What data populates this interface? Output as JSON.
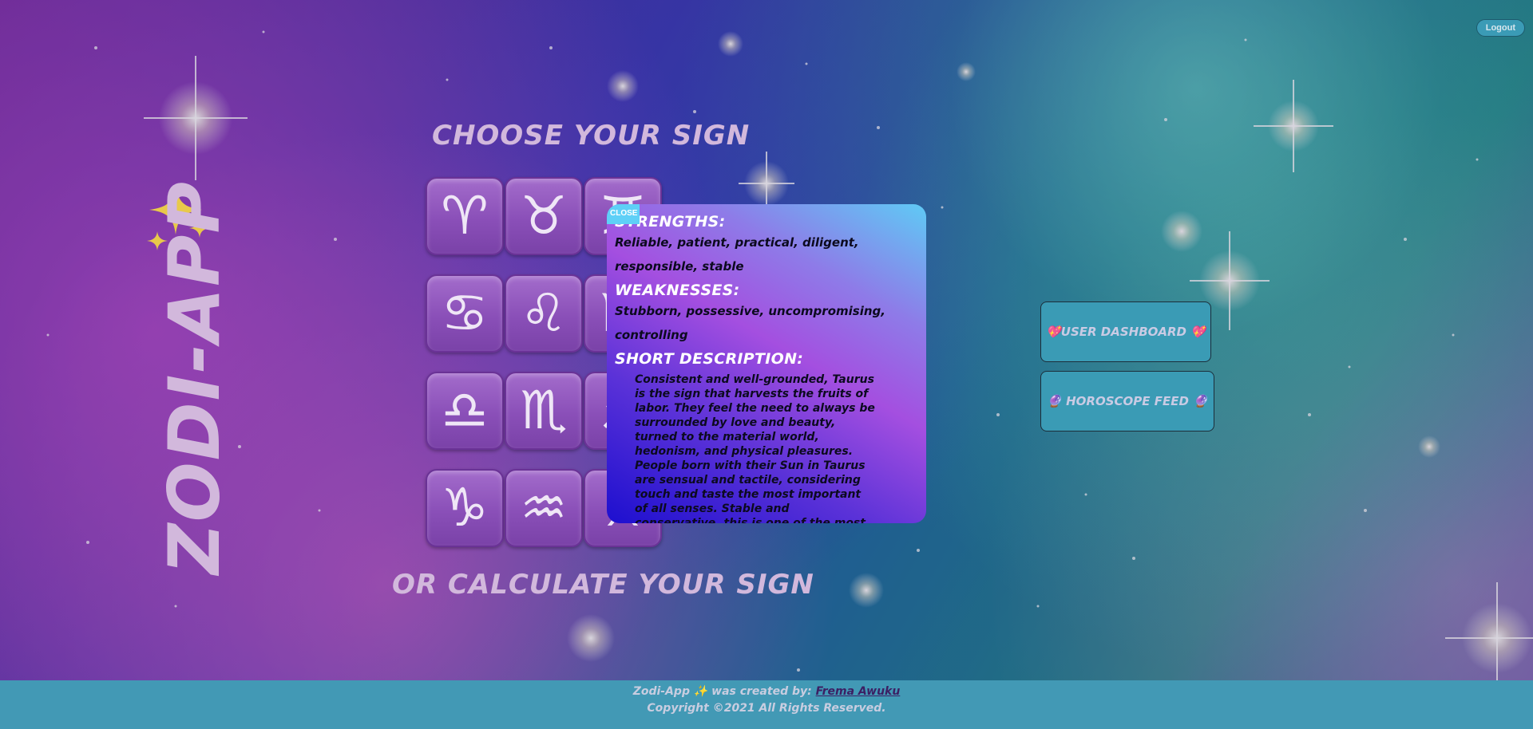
{
  "header": {
    "logout_label": "Logout"
  },
  "brand": {
    "app_title": "ZODI-APP"
  },
  "main": {
    "choose_title": "CHOOSE YOUR SIGN",
    "calculate_title": "OR CALCULATE YOUR SIGN",
    "signs": [
      {
        "glyph": "♈",
        "icon": "aries-icon"
      },
      {
        "glyph": "♉",
        "icon": "taurus-icon"
      },
      {
        "glyph": "♊",
        "icon": "gemini-icon"
      },
      {
        "glyph": "♋",
        "icon": "cancer-icon"
      },
      {
        "glyph": "♌",
        "icon": "leo-icon"
      },
      {
        "glyph": "♍",
        "icon": "virgo-icon"
      },
      {
        "glyph": "♎",
        "icon": "libra-icon"
      },
      {
        "glyph": "♏",
        "icon": "scorpio-icon"
      },
      {
        "glyph": "♐",
        "icon": "sagittarius-icon"
      },
      {
        "glyph": "♑",
        "icon": "capricorn-icon"
      },
      {
        "glyph": "♒",
        "icon": "aquarius-icon"
      },
      {
        "glyph": "♓",
        "icon": "pisces-icon"
      }
    ]
  },
  "modal": {
    "close_label": "CLOSE",
    "strengths_heading": "STRENGTHS:",
    "strengths_text": "Reliable, patient, practical, diligent, responsible, stable",
    "weaknesses_heading": "WEAKNESSES:",
    "weaknesses_text": "Stubborn, possessive, uncompromising, controlling",
    "description_heading": "SHORT DESCRIPTION:",
    "description_text": "Consistent and well-grounded, Taurus is the sign that harvests the fruits of labor. They feel the need to always be surrounded by love and beauty, turned to the material world, hedonism, and physical pleasures. People born with their Sun in Taurus are sensual and tactile, considering touch and taste the most important of all senses. Stable and conservative, this is one of the most dependable signs of the zodiac, ready to endure and stick to their choices until they reach the point of personal"
  },
  "sidebar": {
    "dashboard_label": "💖USER DASHBOARD 💖",
    "feed_label": "🔮 HOROSCOPE FEED 🔮"
  },
  "footer": {
    "credit_prefix": "Zodi-App ✨ was created by:",
    "author_name": "Frema Awuku",
    "copyright": "Copyright ©2021 All Rights Reserved."
  },
  "colors": {
    "accent_teal": "#3a9bb5",
    "title_lilac": "#d2b8dc",
    "tile_purple": "#8a4fb8",
    "close_blue": "#5fd0f7"
  }
}
